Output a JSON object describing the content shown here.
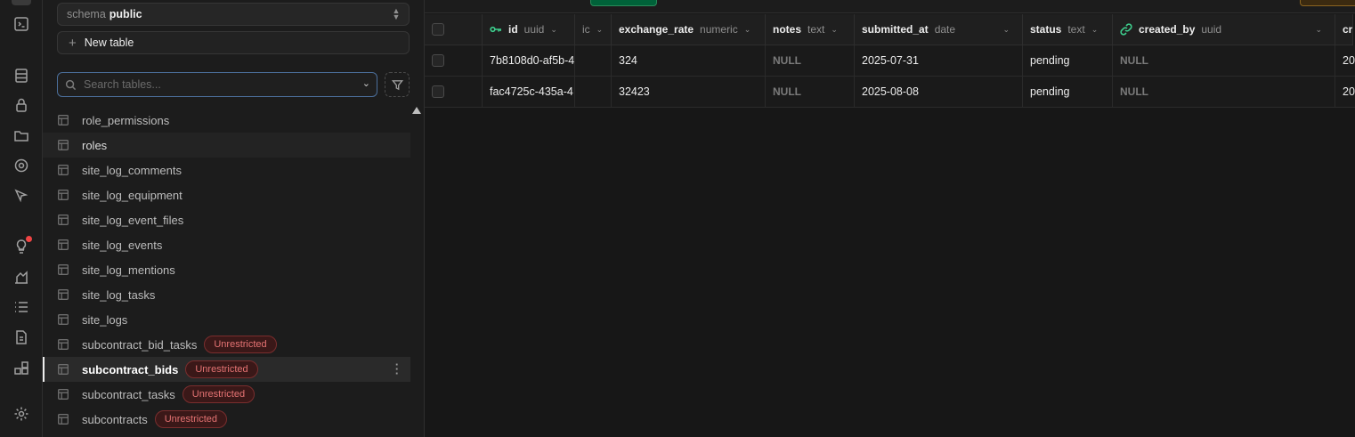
{
  "sidebar": {
    "schema_label": "schema",
    "schema_value": "public",
    "new_table_label": "New table",
    "search_placeholder": "Search tables...",
    "tables": [
      {
        "name": "role_permissions",
        "badge": ""
      },
      {
        "name": "roles",
        "badge": ""
      },
      {
        "name": "site_log_comments",
        "badge": ""
      },
      {
        "name": "site_log_equipment",
        "badge": ""
      },
      {
        "name": "site_log_event_files",
        "badge": ""
      },
      {
        "name": "site_log_events",
        "badge": ""
      },
      {
        "name": "site_log_mentions",
        "badge": ""
      },
      {
        "name": "site_log_tasks",
        "badge": ""
      },
      {
        "name": "site_logs",
        "badge": ""
      },
      {
        "name": "subcontract_bid_tasks",
        "badge": "Unrestricted"
      },
      {
        "name": "subcontract_bids",
        "badge": "Unrestricted"
      },
      {
        "name": "subcontract_tasks",
        "badge": "Unrestricted"
      },
      {
        "name": "subcontracts",
        "badge": "Unrestricted"
      }
    ],
    "active_table": "subcontract_bids",
    "hovered_table": "roles"
  },
  "grid": {
    "columns": [
      {
        "name": "id",
        "type": "uuid",
        "icon": "key-icon"
      },
      {
        "name": "",
        "type": "ic",
        "icon": ""
      },
      {
        "name": "exchange_rate",
        "type": "numeric",
        "icon": ""
      },
      {
        "name": "notes",
        "type": "text",
        "icon": ""
      },
      {
        "name": "submitted_at",
        "type": "date",
        "icon": ""
      },
      {
        "name": "status",
        "type": "text",
        "icon": ""
      },
      {
        "name": "created_by",
        "type": "uuid",
        "icon": "link-icon"
      },
      {
        "name": "cr",
        "type": "",
        "icon": ""
      }
    ],
    "rows": [
      [
        "7b8108d0-af5b-4",
        "",
        "324",
        "NULL",
        "2025-07-31",
        "pending",
        "NULL",
        "20"
      ],
      [
        "fac4725c-435a-4",
        "",
        "32423",
        "NULL",
        "2025-08-08",
        "pending",
        "NULL",
        "20"
      ]
    ]
  },
  "colors": {
    "accent": "#3ecf8e",
    "badge_text": "#e57373",
    "notification": "#ef4444"
  }
}
